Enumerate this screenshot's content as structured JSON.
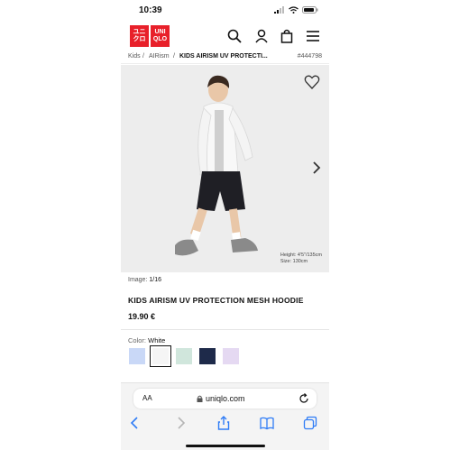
{
  "status_bar": {
    "time": "10:39"
  },
  "logo": {
    "top_text_1": "ユニ",
    "top_text_2": "UNI",
    "bottom_text_1": "クロ",
    "bottom_text_2": "QLO"
  },
  "breadcrumb": {
    "level1": "Kids",
    "sep1": "/",
    "level2": "AIRism",
    "sep2": "/",
    "current": "KIDS AIRISM UV PROTECTI...",
    "product_code": "#444798"
  },
  "hero": {
    "caption_line1": "Height: 4'5\"/135cm",
    "caption_line2": "Size: 130cm"
  },
  "image_counter": {
    "label": "Image:",
    "value": "1/16"
  },
  "product": {
    "title": "KIDS AIRISM UV PROTECTION MESH HOODIE",
    "price": "19.90 €"
  },
  "color": {
    "label": "Color:",
    "selected": "White",
    "swatches": [
      "#c9d8f7",
      "#f5f5f5",
      "#d0e6dc",
      "#1e2a4a",
      "#e5d9f2"
    ]
  },
  "partial_text": "",
  "browser": {
    "aa_label": "AA",
    "url": "uniqlo.com"
  },
  "colors": {
    "brand_red": "#e8202a",
    "ios_blue": "#2f7cf6"
  }
}
